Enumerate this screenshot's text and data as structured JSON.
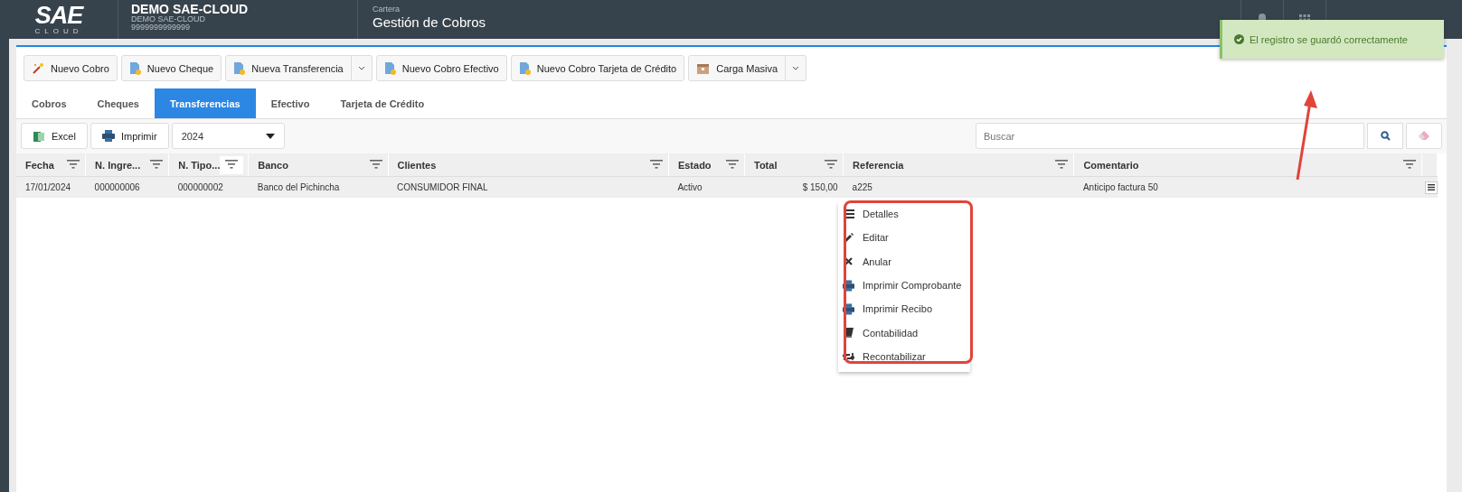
{
  "header": {
    "logo": "SAE",
    "logo_sub": "CLOUD",
    "company": "DEMO SAE-CLOUD",
    "company_sub": "DEMO SAE-CLOUD",
    "ruc": "9999999999999",
    "module": "Cartera",
    "page_title": "Gestión de Cobros"
  },
  "toolbar": [
    {
      "label": "Nuevo Cobro",
      "dropdown": false
    },
    {
      "label": "Nuevo Cheque",
      "dropdown": false
    },
    {
      "label": "Nueva Transferencia",
      "dropdown": true
    },
    {
      "label": "Nuevo Cobro Efectivo",
      "dropdown": false
    },
    {
      "label": "Nuevo Cobro Tarjeta de Crédito",
      "dropdown": false
    },
    {
      "label": "Carga Masiva",
      "dropdown": true
    }
  ],
  "tabs": [
    {
      "label": "Cobros",
      "selected": false
    },
    {
      "label": "Cheques",
      "selected": false
    },
    {
      "label": "Transferencias",
      "selected": true
    },
    {
      "label": "Efectivo",
      "selected": false
    },
    {
      "label": "Tarjeta de Crédito",
      "selected": false
    }
  ],
  "grid_toolbar": {
    "buttons": [
      "Excel",
      "Imprimir"
    ],
    "year": "2024",
    "search_placeholder": "Buscar"
  },
  "table": {
    "columns": [
      {
        "label": "Fecha",
        "filter_active": false
      },
      {
        "label": "N. Ingre...",
        "filter_active": false
      },
      {
        "label": "N. Tipo...",
        "filter_active": true
      },
      {
        "label": "Banco",
        "filter_active": false
      },
      {
        "label": "Clientes",
        "filter_active": false
      },
      {
        "label": "Estado",
        "filter_active": false
      },
      {
        "label": "Total",
        "filter_active": false
      },
      {
        "label": "Referencia",
        "filter_active": false
      },
      {
        "label": "Comentario",
        "filter_active": false
      }
    ],
    "rows": [
      {
        "selected": true,
        "cells": [
          "17/01/2024",
          "000000006",
          "000000002",
          "Banco del Pichincha",
          "CONSUMIDOR FINAL",
          "Activo",
          "$ 150,00",
          "a225",
          "Anticipo factura 50"
        ]
      }
    ]
  },
  "context_menu": {
    "items": [
      "Detalles",
      "Editar",
      "Anular",
      "Imprimir Comprobante",
      "Imprimir Recibo",
      "Contabilidad",
      "Recontabilizar"
    ]
  },
  "toast": {
    "kind": "success",
    "message": "El registro se guardó correctamente"
  }
}
